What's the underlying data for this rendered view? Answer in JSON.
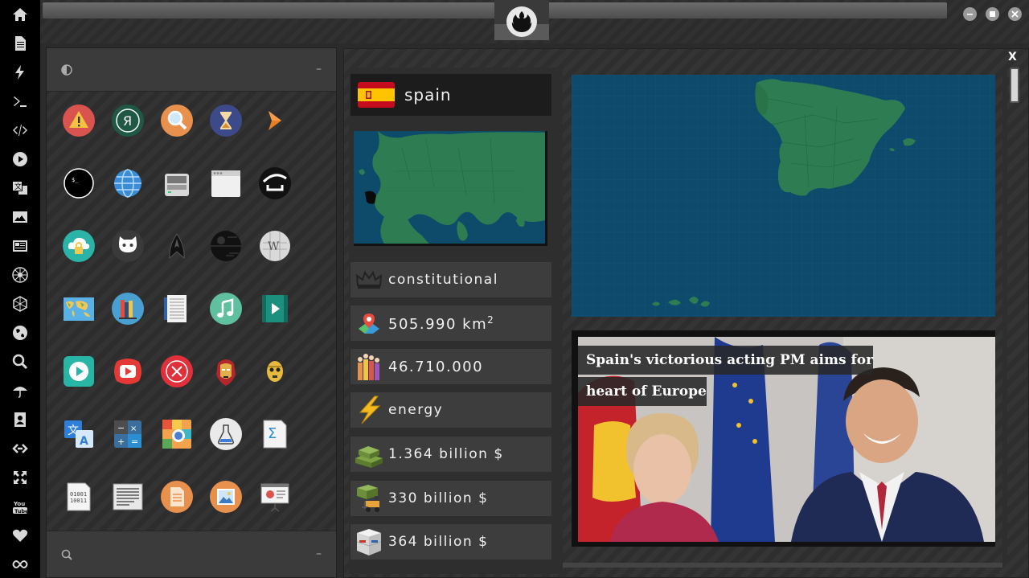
{
  "leftbar": {
    "icons": [
      "home-icon",
      "document-icon",
      "bolt-icon",
      "terminal-icon",
      "code-icon",
      "play-icon",
      "translate-icon",
      "image-icon",
      "news-icon",
      "rebel-icon",
      "hexagon-icon",
      "globe-icon",
      "search-icon",
      "umbrella-icon",
      "contact-icon",
      "link-icon",
      "fullscreen-icon",
      "youtube-icon",
      "heart-icon",
      "infinity-icon"
    ]
  },
  "topbar": {
    "logo": "rebel-alliance-icon",
    "window_buttons": [
      "minimize",
      "maximize",
      "close"
    ]
  },
  "drawer": {
    "header_icon": "contrast-icon",
    "minimize_label": "–",
    "footer_minimize_label": "–",
    "apps": [
      [
        "warning-icon",
        "yandex-icon",
        "search-app-icon",
        "hourglass-icon",
        "arrow-app-icon"
      ],
      [
        "terminal-app-icon",
        "globe-app-icon",
        "scanner-icon",
        "window-app-icon",
        "ubuntu-app-icon"
      ],
      [
        "cloud-lock-icon",
        "github-icon",
        "starfleet-icon",
        "death-star-icon",
        "wikipedia-icon"
      ],
      [
        "world-map-icon",
        "books-icon",
        "document-list-icon",
        "music-icon",
        "video-icon"
      ],
      [
        "media-player-icon",
        "youtube-app-icon",
        "cancel-icon",
        "iron-man-icon",
        "c3po-icon"
      ],
      [
        "translate-app-icon",
        "calculator-icon",
        "photo-browser-icon",
        "flask-icon",
        "sigma-doc-icon"
      ],
      [
        "binary-file-icon",
        "text-editor-icon",
        "file-icon",
        "image-viewer-icon",
        "presentation-icon"
      ]
    ]
  },
  "country": {
    "name": "spain",
    "flag_colors": [
      "#c60b1e",
      "#ffc400"
    ]
  },
  "stats": {
    "government": "constitutional",
    "area": "505.990 km",
    "area_sup": "2",
    "population": "46.710.000",
    "sector": "energy",
    "gdp": "1.364 billion $",
    "exports": "330 billion $",
    "imports": "364 billion $"
  },
  "news": {
    "headline": "Spain's victorious acting PM aims for heart of Europe"
  },
  "close_label": "X",
  "colors": {
    "sea": "#0e4a6c",
    "land": "#2e7d52",
    "highlight": "#0a0a0a"
  }
}
